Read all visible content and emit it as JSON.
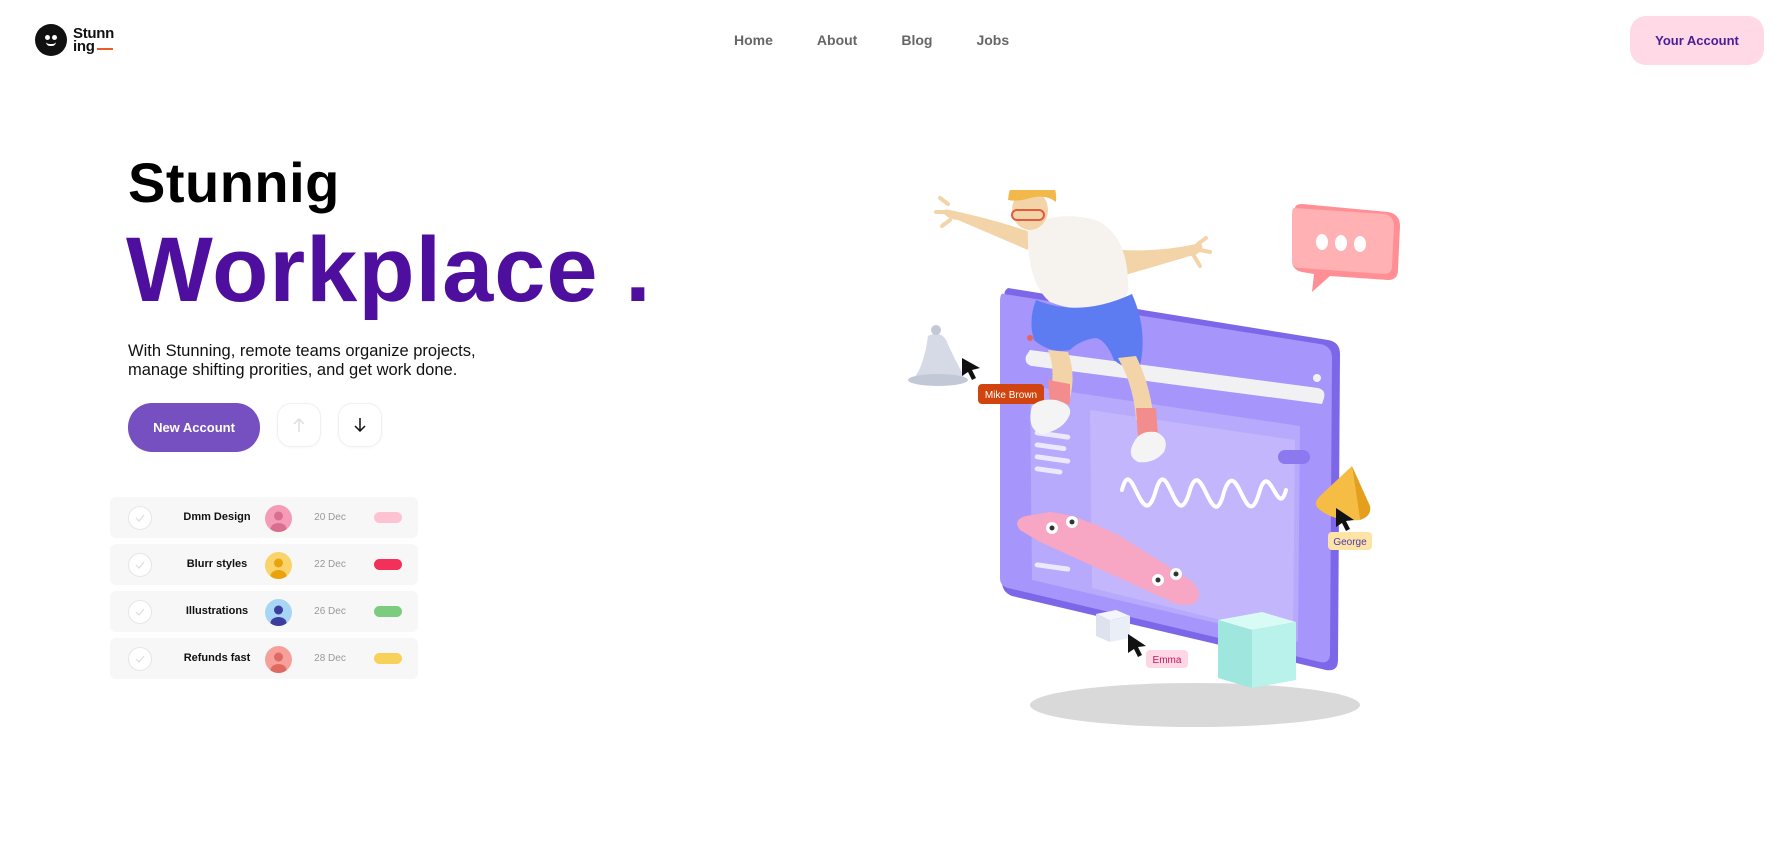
{
  "header": {
    "logo": {
      "line1": "Stunn",
      "line2": "ing"
    },
    "nav": [
      "Home",
      "About",
      "Blog",
      "Jobs"
    ],
    "account_label": "Your Account"
  },
  "hero": {
    "title_line1": "Stunnig",
    "title_line2": "Workplace .",
    "description": "With Stunning, remote teams organize projects, manage shifting prorities, and get work done.",
    "new_account_label": "New Account"
  },
  "tasks": [
    {
      "name": "Dmm Design",
      "date": "20 Dec",
      "avatar_color": "#f59bb7",
      "pill_color": "#ffc2d3"
    },
    {
      "name": "Blurr styles",
      "date": "22 Dec",
      "avatar_color": "#fbd36b",
      "pill_color": "#f2305a"
    },
    {
      "name": "Illustrations",
      "date": "26 Dec",
      "avatar_color": "#a7d5f5",
      "pill_color": "#7ccc7f"
    },
    {
      "name": "Refunds fast",
      "date": "28 Dec",
      "avatar_color": "#f7a09a",
      "pill_color": "#f7d15a"
    }
  ],
  "illustration": {
    "tags": [
      "Mike Brown",
      "George",
      "Emma"
    ]
  },
  "colors": {
    "accent": "#4e0e9e",
    "button": "#7650c0",
    "account_bg": "#ffd9e6"
  }
}
